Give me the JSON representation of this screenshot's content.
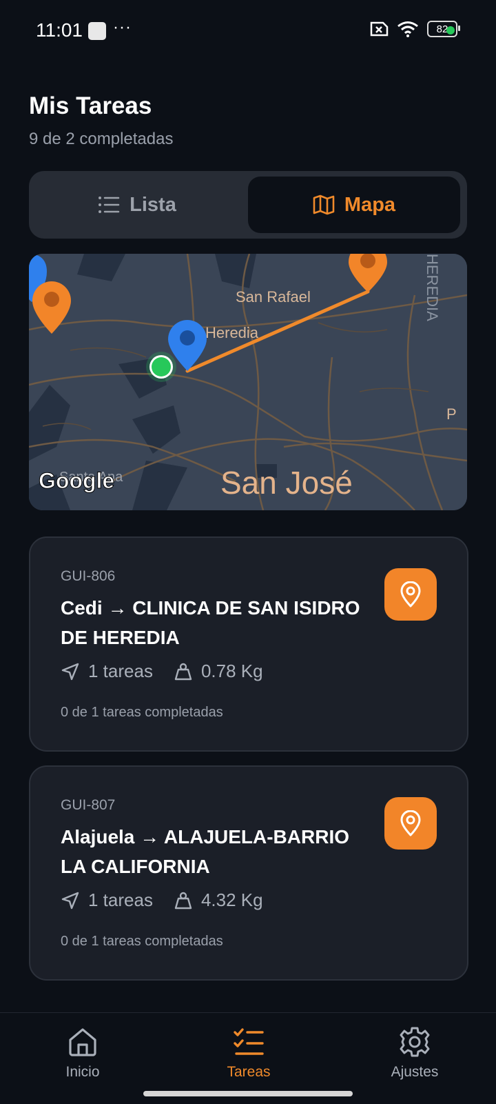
{
  "status_bar": {
    "time": "11:01",
    "dots": "···",
    "battery": "82"
  },
  "header": {
    "title": "Mis Tareas",
    "subtitle": "9 de 2 completadas"
  },
  "view_toggle": {
    "list_label": "Lista",
    "map_label": "Mapa",
    "selected": "Mapa"
  },
  "map": {
    "labels": {
      "san_rafael": "San Rafael",
      "heredia": "Heredia",
      "heredia_vertical": "HEREDIA",
      "santa_ana": "Santa Ana",
      "san_jose": "San José",
      "edge_p": "P"
    },
    "google_logo": "Google"
  },
  "tasks": [
    {
      "code": "GUI-806",
      "title": "Cedi → CLINICA DE SAN ISIDRO DE HEREDIA",
      "tasks_count": "1 tareas",
      "weight": "0.78 Kg",
      "progress": "0 de 1 tareas completadas"
    },
    {
      "code": "GUI-807",
      "title": "Alajuela → ALAJUELA-BARRIO LA CALIFORNIA",
      "tasks_count": "1 tareas",
      "weight": "4.32 Kg",
      "progress": "0 de 1 tareas completadas"
    }
  ],
  "bottom_nav": {
    "home": "Inicio",
    "tasks": "Tareas",
    "settings": "Ajustes",
    "active": "Tareas"
  },
  "colors": {
    "accent": "#f08a2b",
    "background": "#0c1017",
    "card": "#1b1f28",
    "map_pin_blue": "#2f80ed",
    "current_location": "#27c85a"
  }
}
